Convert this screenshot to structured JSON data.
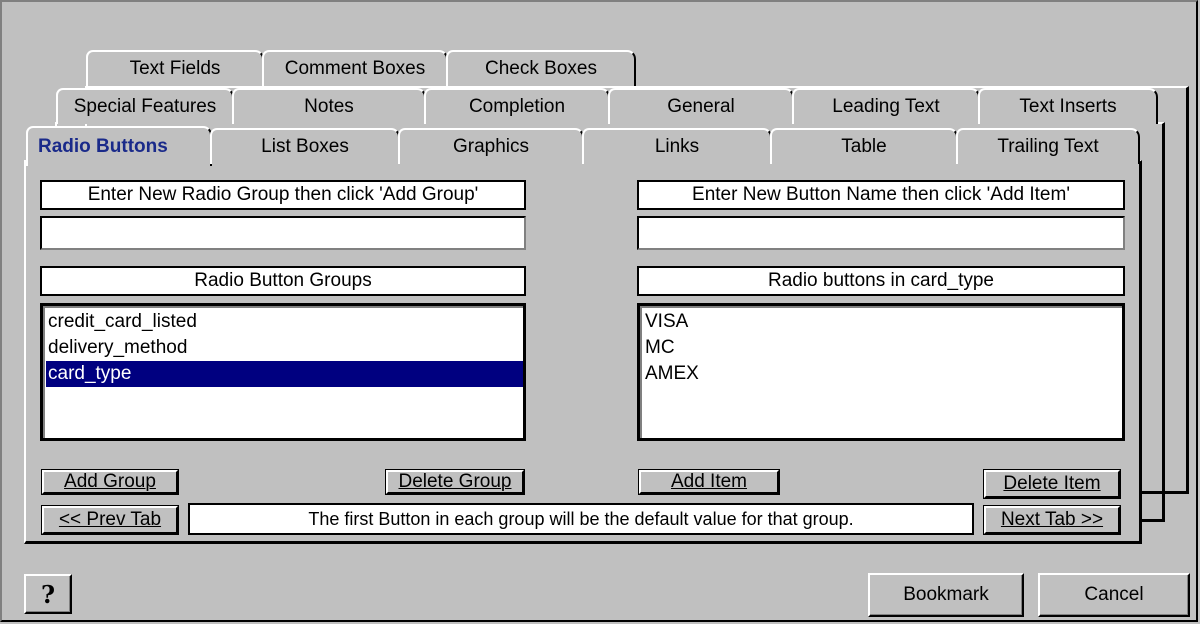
{
  "tabs": {
    "row1": [
      {
        "label": "Text Fields"
      },
      {
        "label": "Comment Boxes"
      },
      {
        "label": "Check Boxes"
      }
    ],
    "row2": [
      {
        "label": "Special Features"
      },
      {
        "label": "Notes"
      },
      {
        "label": "Completion"
      },
      {
        "label": "General"
      },
      {
        "label": "Leading Text"
      },
      {
        "label": "Text Inserts"
      }
    ],
    "row3": [
      {
        "label": "Radio Buttons"
      },
      {
        "label": "List Boxes"
      },
      {
        "label": "Graphics"
      },
      {
        "label": "Links"
      },
      {
        "label": "Table"
      },
      {
        "label": "Trailing Text"
      }
    ]
  },
  "left": {
    "instruction": "Enter New Radio Group then click 'Add Group'",
    "input_value": "",
    "list_header": "Radio Button Groups",
    "items": [
      {
        "label": "credit_card_listed",
        "selected": false
      },
      {
        "label": "delivery_method",
        "selected": false
      },
      {
        "label": "card_type",
        "selected": true
      }
    ],
    "add_button": "Add Group",
    "delete_button": "Delete Group"
  },
  "right": {
    "instruction": "Enter New Button Name then click 'Add Item'",
    "input_value": "",
    "list_header": "Radio buttons in card_type",
    "items": [
      {
        "label": "VISA"
      },
      {
        "label": "MC"
      },
      {
        "label": "AMEX"
      }
    ],
    "add_button": "Add Item",
    "delete_button": "Delete Item"
  },
  "nav": {
    "prev": "<< Prev Tab",
    "next": "Next Tab >>",
    "status": "The first Button in each group will be the default value for that group."
  },
  "footer": {
    "help_glyph": "?",
    "bookmark": "Bookmark",
    "cancel": "Cancel"
  },
  "colors": {
    "face": "#c0c0c0",
    "selection": "#000080",
    "active_tab_text": "#1a2a8a"
  }
}
